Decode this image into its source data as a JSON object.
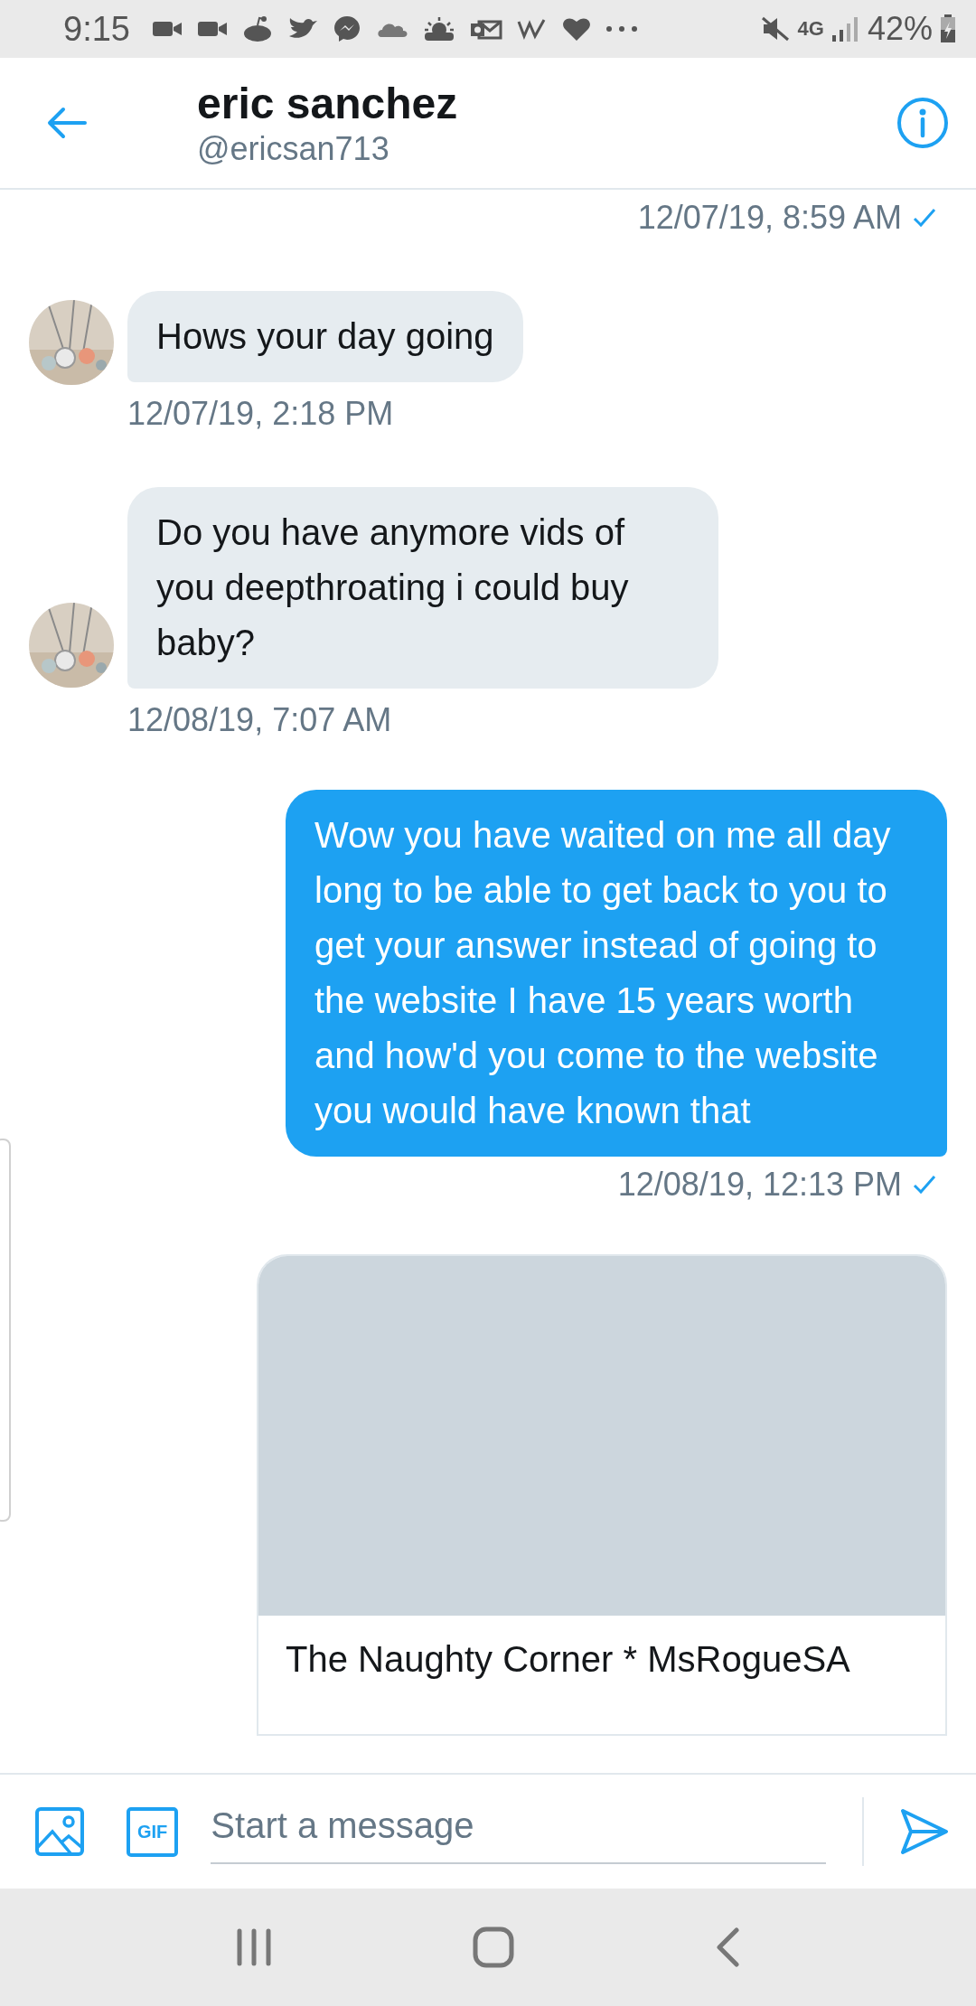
{
  "status_bar": {
    "time": "9:15",
    "network": "4G",
    "battery": "42%"
  },
  "header": {
    "name": "eric sanchez",
    "handle": "@ericsan713"
  },
  "messages": [
    {
      "kind": "timestamp",
      "time": "12/07/19, 8:59 AM",
      "read": true
    },
    {
      "kind": "received",
      "text": "Hows your day going",
      "time": "12/07/19, 2:18 PM"
    },
    {
      "kind": "received",
      "text": "Do you have anymore vids of you deepthroating i could buy baby?",
      "time": "12/08/19, 7:07 AM"
    },
    {
      "kind": "sent",
      "text": "Wow you have waited on me all day long to be able to get back to you to get your answer instead of going to the website I have 15 years worth and how'd you come to the website you would have known that",
      "time": "12/08/19, 12:13 PM",
      "read": true
    },
    {
      "kind": "link_card",
      "title": "The Naughty Corner * MsRogueSA"
    }
  ],
  "composer": {
    "placeholder": "Start a message",
    "gif_label": "GIF"
  }
}
